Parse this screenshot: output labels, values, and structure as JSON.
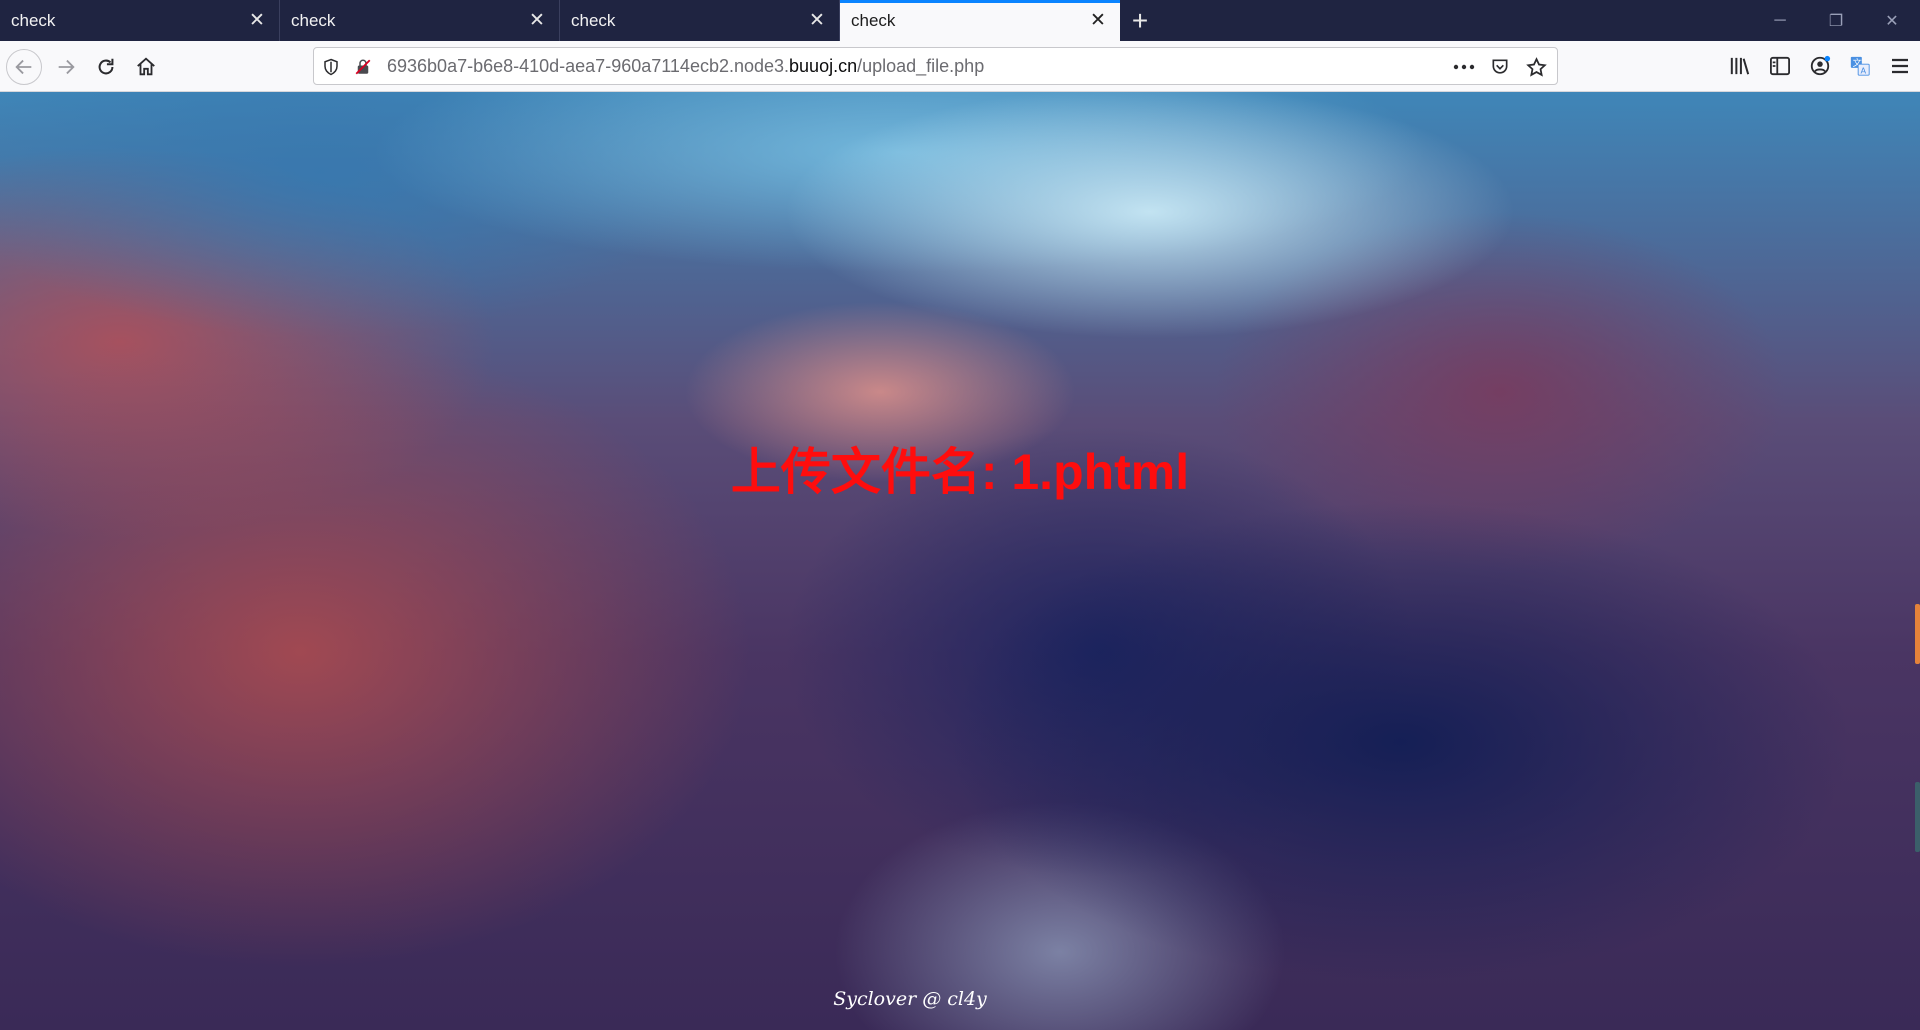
{
  "tabs": [
    {
      "title": "check",
      "active": false
    },
    {
      "title": "check",
      "active": false
    },
    {
      "title": "check",
      "active": false
    },
    {
      "title": "check",
      "active": true
    }
  ],
  "url": {
    "prefix": "6936b0a7-b6e8-410d-aea7-960a7114ecb2.node3.",
    "domain": "buuoj.cn",
    "path": "/upload_file.php"
  },
  "page": {
    "message": "上传文件名: 1.phtml",
    "footer": "Syclover @ cl4y"
  },
  "colors": {
    "message": "#ff0d0d",
    "tabstrip": "#1f2441",
    "active_tab_accent": "#0a84ff"
  },
  "icons": {
    "back": "arrow-left-icon",
    "forward": "arrow-right-icon",
    "reload": "reload-icon",
    "home": "home-icon",
    "shield": "shield-icon",
    "insecure": "insecure-lock-icon",
    "page_actions": "more-icon",
    "pocket": "pocket-icon",
    "bookmark": "star-icon",
    "library": "library-icon",
    "sidebar": "sidebar-icon",
    "account": "account-icon",
    "translate": "translate-icon",
    "menu": "hamburger-menu-icon"
  }
}
